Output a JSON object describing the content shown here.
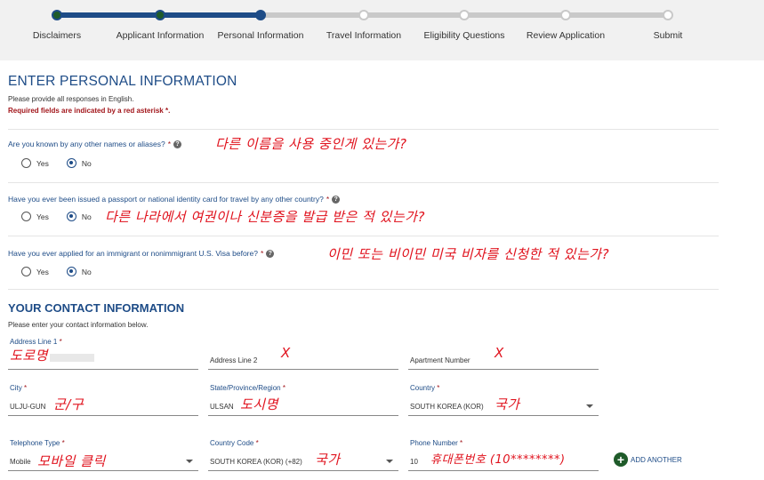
{
  "progress": {
    "steps": [
      "Disclaimers",
      "Applicant Information",
      "Personal Information",
      "Travel Information",
      "Eligibility Questions",
      "Review Application",
      "Submit"
    ]
  },
  "page": {
    "title": "ENTER PERSONAL INFORMATION",
    "english_note": "Please provide all responses in English.",
    "required_note": "Required fields are indicated by a red asterisk *."
  },
  "questions": [
    {
      "text": "Are you known by any other names or aliases?",
      "yes_label": "Yes",
      "no_label": "No",
      "selected": "No",
      "annotation": "다른 이름을 사용 중인게 있는가?"
    },
    {
      "text": "Have you ever been issued a passport or national identity card for travel by any other country?",
      "yes_label": "Yes",
      "no_label": "No",
      "selected": "No",
      "annotation": "다른 나라에서 여권이나 신분증을 발급 받은 적 있는가?"
    },
    {
      "text": "Have you ever applied for an immigrant or nonimmigrant U.S. Visa before?",
      "yes_label": "Yes",
      "no_label": "No",
      "selected": "No",
      "annotation": "이민 또는 비이민 미국 비자를 신청한 적 있는가?"
    }
  ],
  "contact": {
    "title": "YOUR CONTACT INFORMATION",
    "subtitle": "Please enter your contact information below.",
    "address1": {
      "label": "Address Line 1",
      "value": "",
      "annotation": "도로명"
    },
    "address2": {
      "label": "Address Line 2",
      "annotation": "X"
    },
    "apartment": {
      "label": "Apartment Number",
      "annotation": "X"
    },
    "city": {
      "label": "City",
      "value": "ULJU-GUN",
      "annotation": "군/구"
    },
    "state": {
      "label": "State/Province/Region",
      "value": "ULSAN",
      "annotation": "도시명"
    },
    "country": {
      "label": "Country",
      "value": "SOUTH KOREA (KOR)",
      "annotation": "국가"
    },
    "phone_type": {
      "label": "Telephone Type",
      "value": "Mobile",
      "annotation": "모바일 클릭"
    },
    "country_code": {
      "label": "Country Code",
      "value": "SOUTH KOREA (KOR) (+82)",
      "annotation": "국가"
    },
    "phone_number": {
      "label": "Phone Number",
      "value": "10",
      "annotation": "휴대폰번호 (10********)"
    },
    "add_another": "ADD ANOTHER"
  },
  "colors": {
    "primary": "#1e4c87",
    "required": "#a2161b",
    "annotation": "#e0121d",
    "add_green": "#1f5b2a"
  }
}
